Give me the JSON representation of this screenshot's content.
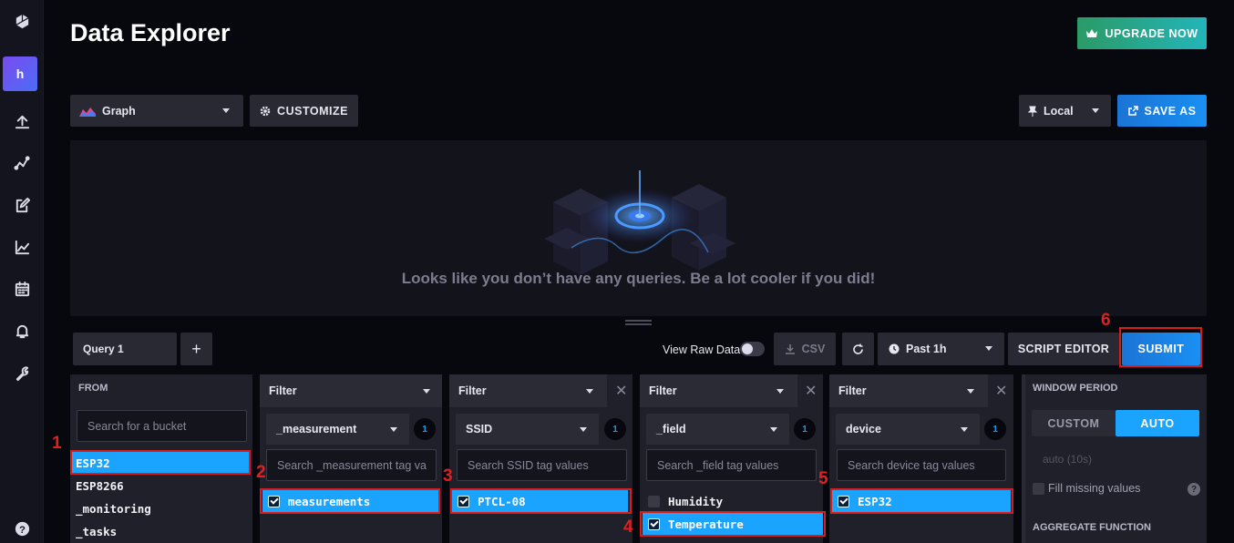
{
  "page": {
    "title": "Data Explorer"
  },
  "sidebar": {
    "avatar_letter": "h"
  },
  "header": {
    "upgrade_label": "UPGRADE NOW"
  },
  "toolbar": {
    "graph_type": "Graph",
    "customize_label": "CUSTOMIZE",
    "timezone": "Local",
    "save_as_label": "SAVE AS"
  },
  "graph": {
    "empty_message": "Looks like you don’t have any queries. Be a lot cooler if you did!"
  },
  "query_bar": {
    "tab_label": "Query 1",
    "add_label": "+",
    "raw_data_label": "View Raw Data",
    "csv_label": "CSV",
    "time_range": "Past 1h",
    "script_editor_label": "SCRIPT EDITOR",
    "submit_label": "SUBMIT"
  },
  "from_panel": {
    "header": "FROM",
    "search_placeholder": "Search for a bucket",
    "buckets": [
      "ESP32",
      "ESP8266",
      "_monitoring",
      "_tasks"
    ]
  },
  "filters": [
    {
      "header": "Filter",
      "key": "_measurement",
      "count": "1",
      "search_placeholder": "Search _measurement tag va",
      "values": [
        {
          "label": "measurements",
          "checked": true
        }
      ]
    },
    {
      "header": "Filter",
      "key": "SSID",
      "count": "1",
      "search_placeholder": "Search SSID tag values",
      "values": [
        {
          "label": "PTCL-08",
          "checked": true
        }
      ]
    },
    {
      "header": "Filter",
      "key": "_field",
      "count": "1",
      "search_placeholder": "Search _field tag values",
      "values": [
        {
          "label": "Humidity",
          "checked": false
        },
        {
          "label": "Temperature",
          "checked": true
        }
      ]
    },
    {
      "header": "Filter",
      "key": "device",
      "count": "1",
      "search_placeholder": "Search device tag values",
      "values": [
        {
          "label": "ESP32",
          "checked": true
        }
      ]
    }
  ],
  "aggregate": {
    "window_period_label": "WINDOW PERIOD",
    "custom_label": "CUSTOM",
    "auto_label": "AUTO",
    "auto_value": "auto (10s)",
    "fill_missing_label": "Fill missing values",
    "function_label": "AGGREGATE FUNCTION"
  },
  "annotations": [
    "1",
    "2",
    "3",
    "4",
    "5",
    "6"
  ],
  "colors": {
    "accent": "#1aa3ff",
    "highlight_box": "#d91c1c",
    "upgrade": "#23b5b9"
  },
  "icons": [
    "logo-icon",
    "upload-icon",
    "pulse-icon",
    "edit-icon",
    "chart-icon",
    "calendar-icon",
    "bell-icon",
    "wrench-icon",
    "help-icon",
    "graph-type-icon",
    "gear-icon",
    "pin-icon",
    "external-link-icon",
    "download-icon",
    "refresh-icon",
    "clock-icon",
    "crown-icon",
    "close-icon"
  ]
}
